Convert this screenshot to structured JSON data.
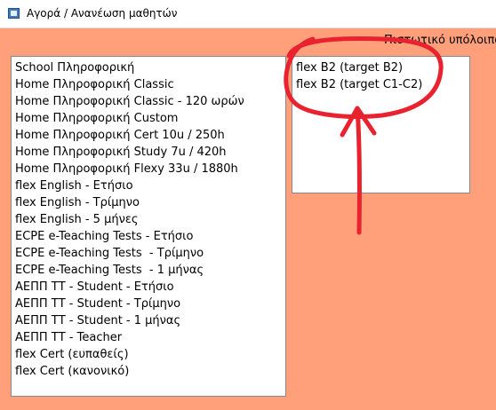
{
  "window": {
    "title": "Αγορά / Ανανέωση μαθητών"
  },
  "credit": {
    "label": "Πιστωτικό υπόλοιπο"
  },
  "products": [
    "School Πληροφορική",
    "Home Πληροφορική Classic",
    "Home Πληροφορική Classic - 120 ωρών",
    "Home Πληροφορική Custom",
    "Home Πληροφορική Cert 10u / 250h",
    "Home Πληροφορική Study 7u / 420h",
    "Home Πληροφορική Flexy 33u / 1880h",
    "flex English - Ετήσιο",
    "flex English - Τρίμηνο",
    "flex English - 5 μήνες",
    "ECPE e-Teaching Tests - Ετήσιο",
    "ECPE e-Teaching Tests  - Τρίμηνο",
    "ECPE e-Teaching Tests  - 1 μήνας",
    "ΑΕΠΠ ΤΤ - Student - Ετήσιο",
    "ΑΕΠΠ ΤΤ - Student - Τρίμηνο",
    "ΑΕΠΠ ΤΤ - Student - 1 μήνας",
    "ΑΕΠΠ ΤΤ - Teacher",
    "flex Cert (ευπαθείς)",
    "flex Cert (κανονικό)"
  ],
  "selected": [
    "flex B2 (target B2)",
    "flex B2 (target C1-C2)"
  ],
  "colors": {
    "background": "#ffa07a",
    "annotation": "#e8232f"
  }
}
